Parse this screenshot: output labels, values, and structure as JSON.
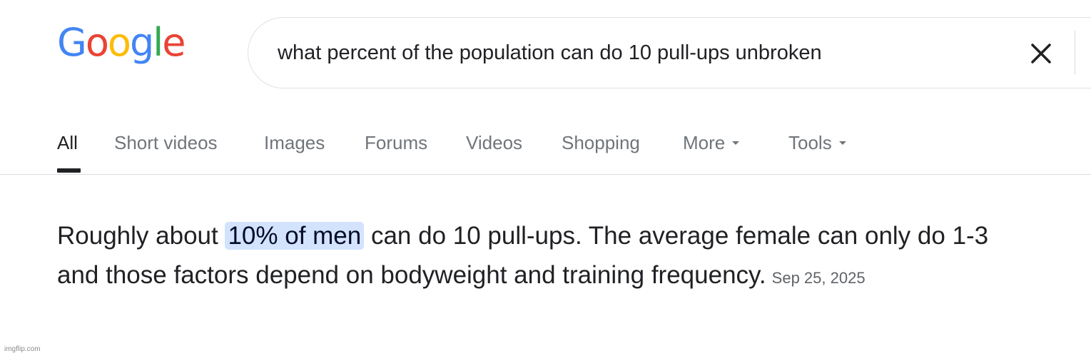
{
  "logo": {
    "letters": [
      "G",
      "o",
      "o",
      "g",
      "l",
      "e"
    ],
    "colors": [
      "#4285F4",
      "#EA4335",
      "#FBBC05",
      "#4285F4",
      "#34A853",
      "#EA4335"
    ]
  },
  "search": {
    "query": "what percent of the population can do 10 pull-ups unbroken",
    "clear_icon": "close-icon"
  },
  "tabs": [
    {
      "label": "All",
      "active": true
    },
    {
      "label": "Short videos"
    },
    {
      "label": "Images"
    },
    {
      "label": "Forums"
    },
    {
      "label": "Videos"
    },
    {
      "label": "Shopping"
    },
    {
      "label": "More",
      "icon": "caret-down-icon"
    },
    {
      "label": "Tools",
      "icon": "caret-down-icon"
    }
  ],
  "answer": {
    "text_before": "Roughly about ",
    "highlight": "10% of men",
    "text_after": " can do 10 pull-ups. The average female can only do 1-3 and those factors depend on bodyweight and training frequency.",
    "date": "Sep 25, 2025"
  },
  "watermark": "imgflip.com",
  "colors": {
    "highlight_bg": "#d3e3fd",
    "text": "#202124",
    "muted": "#70757a"
  }
}
